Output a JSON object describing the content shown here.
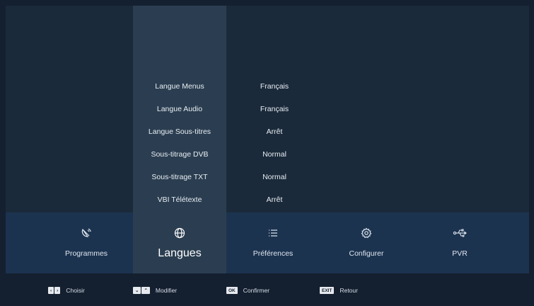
{
  "settings": [
    {
      "label": "Langue Menus",
      "value": "Français"
    },
    {
      "label": "Langue Audio",
      "value": "Français"
    },
    {
      "label": "Langue Sous-titres",
      "value": "Arrêt"
    },
    {
      "label": "Sous-titrage DVB",
      "value": "Normal"
    },
    {
      "label": "Sous-titrage TXT",
      "value": "Normal"
    },
    {
      "label": "VBI Télétexte",
      "value": "Arrêt"
    }
  ],
  "menu": [
    {
      "label": "Programmes",
      "icon": "satellite-dish-icon"
    },
    {
      "label": "Langues",
      "icon": "globe-icon"
    },
    {
      "label": "Préférences",
      "icon": "list-icon"
    },
    {
      "label": "Configurer",
      "icon": "gear-icon"
    },
    {
      "label": "PVR",
      "icon": "usb-icon"
    }
  ],
  "hints": [
    {
      "keys": [
        "‹",
        "›"
      ],
      "label": "Choisir"
    },
    {
      "keys": [
        "⌄",
        "⌃"
      ],
      "label": "Modifier"
    },
    {
      "keys": [
        "OK"
      ],
      "label": "Confirmer"
    },
    {
      "keys": [
        "EXIT"
      ],
      "label": "Retour"
    }
  ],
  "colors": {
    "background": "#142030",
    "panel": "#1a2a3a",
    "highlight": "#2b3e51",
    "menu_bar": "#1c3350"
  }
}
